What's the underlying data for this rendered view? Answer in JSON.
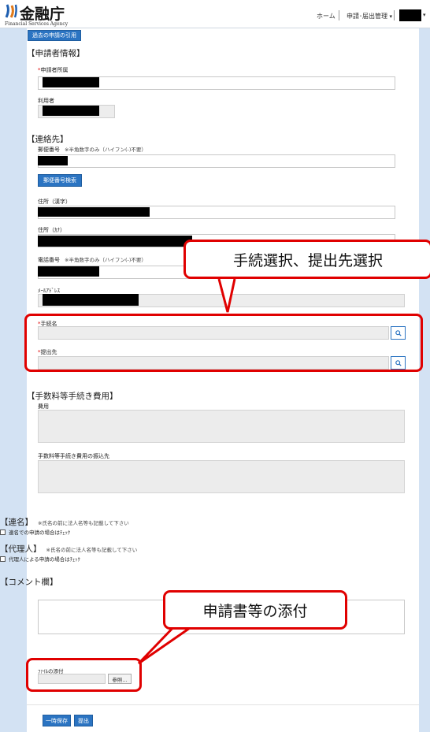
{
  "header": {
    "logo_text": "金融庁",
    "logo_sub": "Financial Services Agency",
    "nav_home": "ホーム",
    "nav_apply": "申請･届出管理",
    "nav_arrow": "▾",
    "user_arrow": "▾"
  },
  "form": {
    "prev_apply_button": "過去の申請の引用",
    "applicant_section": "【申請者情報】",
    "applicant_affiliation_label": "申請者所属",
    "user_label": "利用者",
    "contact_section": "【連絡先】",
    "postal_label": "郵便番号",
    "postal_note": "※半角数字のみ（ハイフン(-)不要）",
    "postal_search_button": "郵便番号検索",
    "address_kanji_label": "住所（漢字）",
    "address_kana_label": "住所（ｶﾅ）",
    "phone_label": "電話番号",
    "phone_note": "※半角数字のみ（ハイフン(-)不要）",
    "email_label": "ﾒｰﾙｱﾄﾞﾚｽ",
    "procedure_label": "手続名",
    "submit_to_label": "提出先",
    "required_mark": "*",
    "fee_section": "【手数料等手続き費用】",
    "cost_label": "費用",
    "fee_account_label": "手数料等手続き費用の振込先",
    "joint_section": "【連名】",
    "joint_note": "※氏名の前に法人名等も記載して下さい",
    "joint_check": "連名での申請の場合はﾁｪｯｸ",
    "agent_section": "【代理人】",
    "agent_note": "※氏名の前に法人名等も記載して下さい",
    "agent_check": "代理人による申請の場合はﾁｪｯｸ",
    "comment_section": "【コメント欄】",
    "file_label": "ﾌｧｲﾙの添付",
    "browse_button": "参照...",
    "save_button": "一時保存",
    "submit_button": "提出"
  },
  "callouts": {
    "procedure": "手続選択、提出先選択",
    "attachment": "申請書等の添付"
  },
  "colors": {
    "accent": "#2b74c2",
    "highlight": "#e00000",
    "background": "#d3e2f3"
  }
}
